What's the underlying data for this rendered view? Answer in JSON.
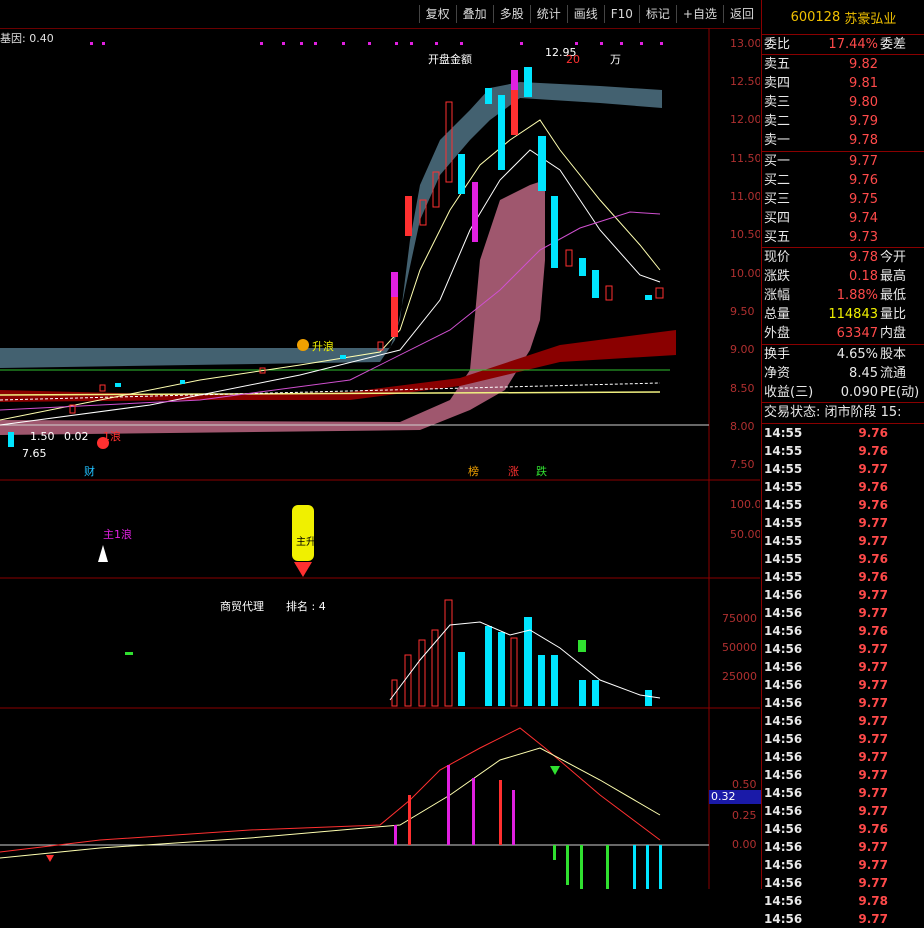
{
  "toolbar": {
    "buttons": [
      "复权",
      "叠加",
      "多股",
      "统计",
      "画线",
      "F10",
      "标记",
      "+自选",
      "返回"
    ]
  },
  "chart": {
    "gene_label": "基因: 0.40",
    "price_axis": [
      "13.00",
      "12.50",
      "12.00",
      "11.50",
      "11.00",
      "10.50",
      "10.00",
      "9.50",
      "9.00",
      "8.50",
      "8.00",
      "7.50"
    ],
    "high_mark": "12.95",
    "low_mark": "7.65",
    "amount_label": "开盘金额",
    "amount_value": "20",
    "amount_unit": "万",
    "wave_label": "升浪",
    "wave1_label": "1浪",
    "left_labels": [
      "1.50",
      "0.02"
    ],
    "badges": {
      "cai": "财",
      "bang": "榜",
      "zhang": "涨",
      "die": "跌"
    },
    "panel2_axis": [
      "100.0",
      "50.00"
    ],
    "panel2_label": "主1浪",
    "rocket_text": "主升浪",
    "panel3_axis": [
      "75000",
      "50000",
      "25000"
    ],
    "panel3_sector": "商贸代理",
    "panel3_rank": "排名 : 4",
    "panel4_axis": [
      "0.50",
      "0.25",
      "0.00"
    ],
    "panel4_badge": "0.32",
    "colors": {
      "up": "#ff3030",
      "down": "#00e5ff",
      "border": "#8a0000",
      "accent": "#f0c000"
    }
  },
  "quote": {
    "code": "600128",
    "name": "苏豪弘业",
    "weibi": {
      "label": "委比",
      "value": "17.44%",
      "right": "委差"
    },
    "asks": [
      {
        "label": "卖五",
        "price": "9.82"
      },
      {
        "label": "卖四",
        "price": "9.81"
      },
      {
        "label": "卖三",
        "price": "9.80"
      },
      {
        "label": "卖二",
        "price": "9.79"
      },
      {
        "label": "卖一",
        "price": "9.78"
      }
    ],
    "bids": [
      {
        "label": "买一",
        "price": "9.77"
      },
      {
        "label": "买二",
        "price": "9.76"
      },
      {
        "label": "买三",
        "price": "9.75"
      },
      {
        "label": "买四",
        "price": "9.74"
      },
      {
        "label": "买五",
        "price": "9.73"
      }
    ],
    "stats1": [
      {
        "label": "现价",
        "value": "9.78",
        "right": "今开"
      },
      {
        "label": "涨跌",
        "value": "0.18",
        "right": "最高"
      },
      {
        "label": "涨幅",
        "value": "1.88%",
        "right": "最低"
      },
      {
        "label": "总量",
        "value": "114843",
        "right": "量比"
      },
      {
        "label": "外盘",
        "value": "63347",
        "right": "内盘"
      }
    ],
    "stats2": [
      {
        "label": "换手",
        "value": "4.65%",
        "right": "股本"
      },
      {
        "label": "净资",
        "value": "8.45",
        "right": "流通"
      },
      {
        "label": "收益(三)",
        "value": "0.090",
        "right": "PE(动)"
      }
    ],
    "state": "交易状态: 闭市阶段 15:",
    "ticks": [
      {
        "t": "14:55",
        "p": "9.76"
      },
      {
        "t": "14:55",
        "p": "9.76"
      },
      {
        "t": "14:55",
        "p": "9.77"
      },
      {
        "t": "14:55",
        "p": "9.76"
      },
      {
        "t": "14:55",
        "p": "9.76"
      },
      {
        "t": "14:55",
        "p": "9.77"
      },
      {
        "t": "14:55",
        "p": "9.77"
      },
      {
        "t": "14:55",
        "p": "9.76"
      },
      {
        "t": "14:55",
        "p": "9.76"
      },
      {
        "t": "14:56",
        "p": "9.77"
      },
      {
        "t": "14:56",
        "p": "9.77"
      },
      {
        "t": "14:56",
        "p": "9.76"
      },
      {
        "t": "14:56",
        "p": "9.77"
      },
      {
        "t": "14:56",
        "p": "9.77"
      },
      {
        "t": "14:56",
        "p": "9.77"
      },
      {
        "t": "14:56",
        "p": "9.77"
      },
      {
        "t": "14:56",
        "p": "9.77"
      },
      {
        "t": "14:56",
        "p": "9.77"
      },
      {
        "t": "14:56",
        "p": "9.77"
      },
      {
        "t": "14:56",
        "p": "9.77"
      },
      {
        "t": "14:56",
        "p": "9.77"
      },
      {
        "t": "14:56",
        "p": "9.77"
      },
      {
        "t": "14:56",
        "p": "9.76"
      },
      {
        "t": "14:56",
        "p": "9.77"
      },
      {
        "t": "14:56",
        "p": "9.77"
      },
      {
        "t": "14:56",
        "p": "9.77"
      },
      {
        "t": "14:56",
        "p": "9.78"
      },
      {
        "t": "14:56",
        "p": "9.77"
      }
    ]
  }
}
